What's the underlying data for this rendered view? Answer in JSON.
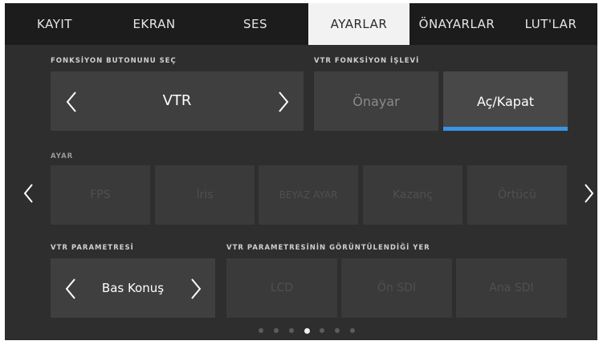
{
  "tabs": [
    {
      "label": "KAYIT",
      "active": false
    },
    {
      "label": "EKRAN",
      "active": false
    },
    {
      "label": "SES",
      "active": false
    },
    {
      "label": "AYARLAR",
      "active": true
    },
    {
      "label": "ÖNAYARLAR",
      "active": false
    },
    {
      "label": "LUT'LAR",
      "active": false
    }
  ],
  "function_button": {
    "label": "FONKSİYON BUTONUNU SEÇ",
    "value": "VTR"
  },
  "vtr_function": {
    "label": "VTR FONKSİYON İŞLEVİ",
    "options": [
      "Önayar",
      "Aç/Kapat"
    ],
    "selected": "Aç/Kapat"
  },
  "setting": {
    "label": "AYAR",
    "options": [
      "FPS",
      "İris",
      "BEYAZ AYAR",
      "Kazanç",
      "Örtücü"
    ]
  },
  "vtr_parameter": {
    "label": "VTR PARAMETRESİ",
    "value": "Bas Konuş"
  },
  "vtr_display": {
    "label": "VTR PARAMETRESİNİN GÖRÜNTÜLENDİĞİ YER",
    "options": [
      "LCD",
      "Ön SDI",
      "Ana SDI"
    ]
  },
  "pagination": {
    "total": 7,
    "current": 4
  },
  "colors": {
    "accent": "#3a93e6",
    "tab_active_bg": "#f2f2f2",
    "panel_bg": "#2e2e2e"
  }
}
